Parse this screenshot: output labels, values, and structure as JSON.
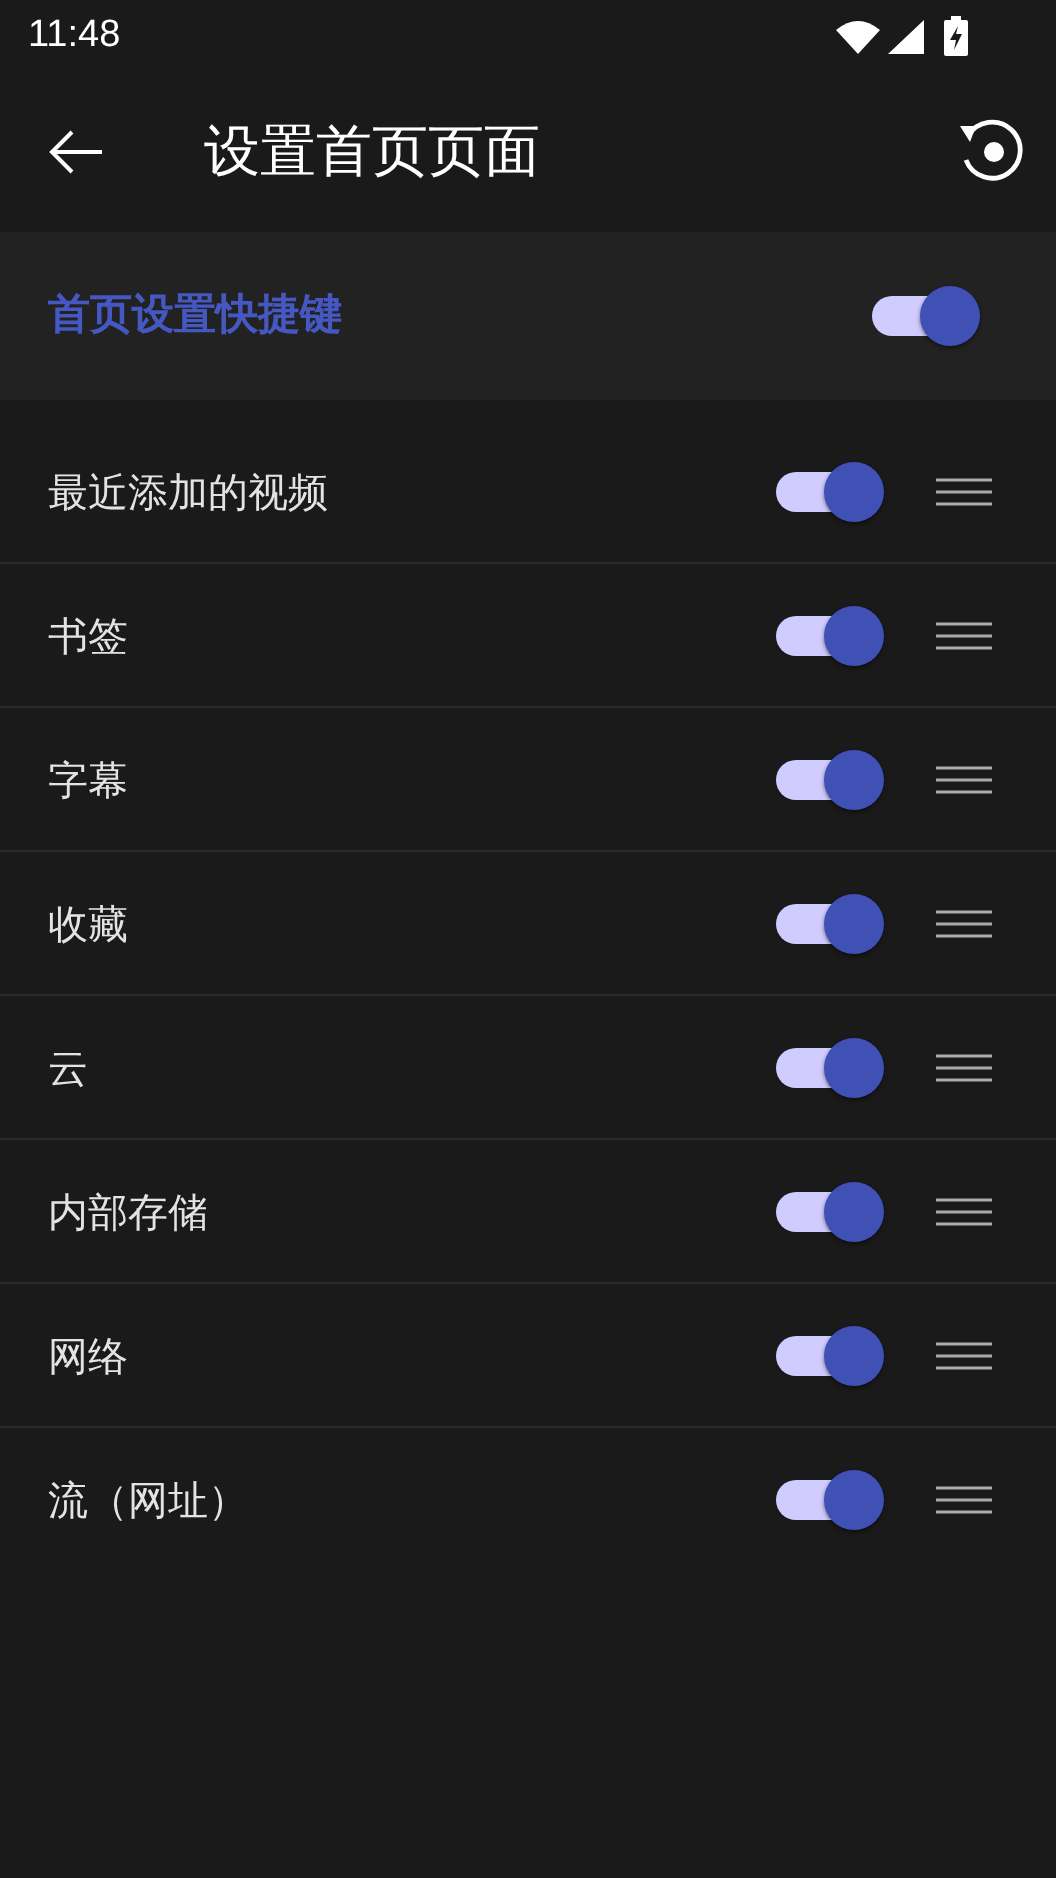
{
  "status_bar": {
    "time": "11:48"
  },
  "toolbar": {
    "title": "设置首页页面"
  },
  "master": {
    "label": "首页设置快捷键",
    "on": true
  },
  "items": [
    {
      "label": "最近添加的视频",
      "on": true
    },
    {
      "label": "书签",
      "on": true
    },
    {
      "label": "字幕",
      "on": true
    },
    {
      "label": "收藏",
      "on": true
    },
    {
      "label": "云",
      "on": true
    },
    {
      "label": "内部存储",
      "on": true
    },
    {
      "label": "网络",
      "on": true
    },
    {
      "label": "流（网址）",
      "on": true
    }
  ]
}
